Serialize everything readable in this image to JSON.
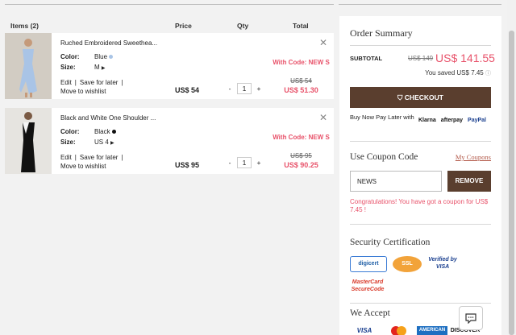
{
  "columns": {
    "items": "Items (2)",
    "price": "Price",
    "qty": "Qty",
    "total": "Total"
  },
  "items": [
    {
      "name": "Ruched Embroidered Sweethea...",
      "color_label": "Color:",
      "color_value": "Blue",
      "size_label": "Size:",
      "size_value": "M",
      "edit": "Edit",
      "save_later": "Save for later",
      "wishlist": "Move to wishlist",
      "price": "US$ 54",
      "qty": "1",
      "code_label": "With Code: NEW S",
      "old_total": "US$ 54",
      "new_total": "US$ 51.30",
      "swatch_color": "#a9c4e6"
    },
    {
      "name": "Black and White One Shoulder ...",
      "color_label": "Color:",
      "color_value": "Black",
      "size_label": "Size:",
      "size_value": "US 4",
      "edit": "Edit",
      "save_later": "Save for later",
      "wishlist": "Move to wishlist",
      "price": "US$ 95",
      "qty": "1",
      "code_label": "With Code: NEW S",
      "old_total": "US$ 95",
      "new_total": "US$ 90.25",
      "swatch_color": "#111111"
    }
  ],
  "summary": {
    "title": "Order Summary",
    "subtotal_label": "SUBTOTAL",
    "subtotal_old": "US$ 149",
    "subtotal_new": "US$ 141.55",
    "saved": "You saved US$ 7.45",
    "checkout": "CHECKOUT",
    "bnpl": "Buy Now Pay Later with",
    "bnpl_logos": [
      "Klarna",
      "afterpay",
      "PayPal"
    ]
  },
  "coupon": {
    "title": "Use Coupon Code",
    "my_coupons": "My Coupons",
    "value": "NEWS",
    "remove": "REMOVE",
    "message": "Congratulations! You have got a coupon for US$ 7.45 !"
  },
  "security": {
    "title": "Security Certification",
    "badges": [
      "digicert",
      "SSL",
      "Verified by VISA",
      "MasterCard SecureCode"
    ]
  },
  "accept": {
    "title": "We Accept",
    "cards": [
      "VISA",
      "MC",
      "AMERICAN",
      "DISCOVER"
    ]
  },
  "colors": {
    "accent": "#e8526a",
    "brand": "#5a3e2e"
  }
}
